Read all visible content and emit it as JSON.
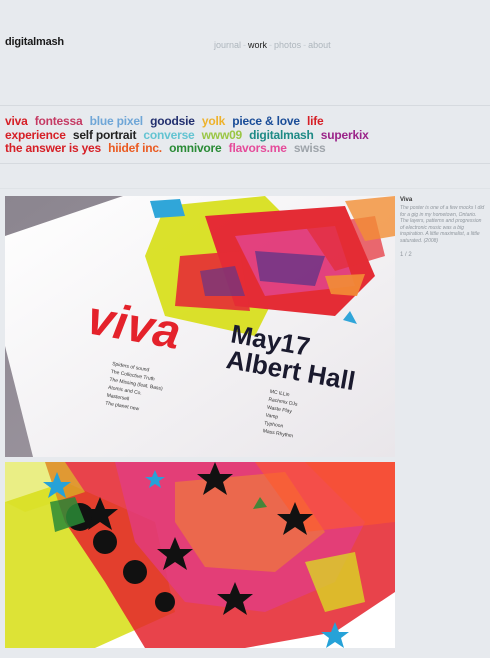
{
  "site": {
    "logo": "digitalmash"
  },
  "nav": {
    "items": [
      {
        "label": "journal"
      },
      {
        "label": "work"
      },
      {
        "label": "photos"
      },
      {
        "label": "about"
      }
    ],
    "separator": "-"
  },
  "tags": [
    {
      "label": "viva",
      "color": "#d61f26"
    },
    {
      "label": "fontessa",
      "color": "#c53a63"
    },
    {
      "label": "blue pixel",
      "color": "#6fa6d7"
    },
    {
      "label": "goodsie",
      "color": "#23306f"
    },
    {
      "label": "yolk",
      "color": "#eeb22c"
    },
    {
      "label": "piece & love",
      "color": "#1b4d98"
    },
    {
      "label": "life experience",
      "color": "#d61f26"
    },
    {
      "label": "self portrait",
      "color": "#222222"
    },
    {
      "label": "converse",
      "color": "#64c4d2"
    },
    {
      "label": "www09",
      "color": "#9ac645"
    },
    {
      "label": "digitalmash",
      "color": "#1e8a85"
    },
    {
      "label": "superkix",
      "color": "#9b2489"
    },
    {
      "label": "the answer is yes",
      "color": "#d61f26"
    },
    {
      "label": "hiidef inc.",
      "color": "#ea5b22"
    },
    {
      "label": "omnivore",
      "color": "#2a8b36"
    },
    {
      "label": "flavors.me",
      "color": "#e54b9a"
    },
    {
      "label": "swiss",
      "color": "#9ea4aa"
    }
  ],
  "project": {
    "title": "Viva",
    "description": "The poster is one of a few mocks I did for a gig in my hometown, Ontario. The layers, patterns and progression of electronic music was a big inspiration. A little maximalist, a little saturated. (2008)",
    "pager": "1 / 2"
  },
  "poster": {
    "word": "viva",
    "date": "May17",
    "venue": "Albert Hall",
    "lineup_left": [
      "Spiders of sound",
      "The Collective Truth",
      "The Missing (feat. Bass)",
      "Atomic and Co.",
      "Mastersell",
      "The planet new"
    ],
    "lineup_right": [
      "MC ILLin",
      "Rachmix DJs",
      "Waste Play",
      "Vamp",
      "Typhoon",
      "Mass Rhythm"
    ]
  },
  "colors": {
    "red": "#e4222b",
    "pink": "#e23c86",
    "yellow": "#d9e020",
    "purple": "#5f2b82",
    "blue": "#26a2d8",
    "black": "#111111",
    "orange": "#f28a2b"
  }
}
